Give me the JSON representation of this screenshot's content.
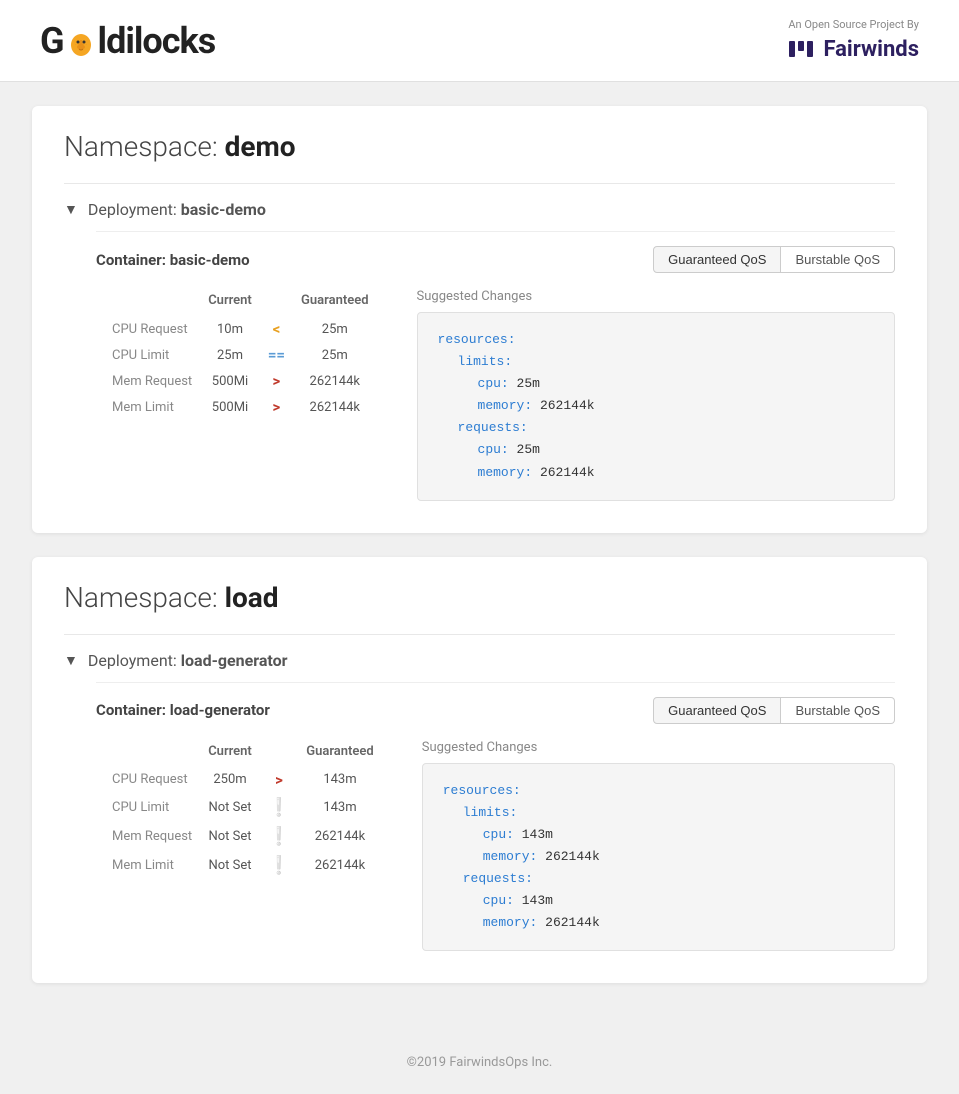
{
  "header": {
    "logo_text_before": "G",
    "logo_text_after": "ldilocks",
    "brand_tagline": "An Open Source Project By",
    "brand_name": "Fairwinds"
  },
  "footer": {
    "copyright": "©2019 FairwindsOps Inc."
  },
  "namespaces": [
    {
      "id": "demo",
      "label": "Namespace:",
      "name": "demo",
      "deployments": [
        {
          "label": "Deployment:",
          "name": "basic-demo",
          "containers": [
            {
              "name": "basic-demo",
              "qos_buttons": [
                "Guaranteed QoS",
                "Burstable QoS"
              ],
              "active_qos": 0,
              "columns": [
                "Current",
                "Guaranteed"
              ],
              "suggested_label": "Suggested Changes",
              "rows": [
                {
                  "label": "CPU Request",
                  "current": "10m",
                  "indicator": "<",
                  "indicator_class": "lt",
                  "guaranteed": "25m"
                },
                {
                  "label": "CPU Limit",
                  "current": "25m",
                  "indicator": "=",
                  "indicator_class": "eq",
                  "guaranteed": "25m"
                },
                {
                  "label": "Mem Request",
                  "current": "500Mi",
                  "indicator": ">",
                  "indicator_class": "gt",
                  "guaranteed": "262144k"
                },
                {
                  "label": "Mem Limit",
                  "current": "500Mi",
                  "indicator": ">",
                  "indicator_class": "gt",
                  "guaranteed": "262144k"
                }
              ],
              "code": {
                "resources_key": "resources:",
                "limits_key": "  limits:",
                "limits_cpu_key": "    cpu:",
                "limits_cpu_val": "25m",
                "limits_mem_key": "    memory:",
                "limits_mem_val": "262144k",
                "requests_key": "  requests:",
                "requests_cpu_key": "    cpu:",
                "requests_cpu_val": "25m",
                "requests_mem_key": "    memory:",
                "requests_mem_val": "262144k"
              }
            }
          ]
        }
      ]
    },
    {
      "id": "load",
      "label": "Namespace:",
      "name": "load",
      "deployments": [
        {
          "label": "Deployment:",
          "name": "load-generator",
          "containers": [
            {
              "name": "load-generator",
              "qos_buttons": [
                "Guaranteed QoS",
                "Burstable QoS"
              ],
              "active_qos": 0,
              "columns": [
                "Current",
                "Guaranteed"
              ],
              "suggested_label": "Suggested Changes",
              "rows": [
                {
                  "label": "CPU Request",
                  "current": "250m",
                  "indicator": ">",
                  "indicator_class": "gt",
                  "guaranteed": "143m"
                },
                {
                  "label": "CPU Limit",
                  "current": "Not Set",
                  "indicator": "!",
                  "indicator_class": "warn",
                  "guaranteed": "143m"
                },
                {
                  "label": "Mem Request",
                  "current": "Not Set",
                  "indicator": "!",
                  "indicator_class": "warn",
                  "guaranteed": "262144k"
                },
                {
                  "label": "Mem Limit",
                  "current": "Not Set",
                  "indicator": "!",
                  "indicator_class": "warn",
                  "guaranteed": "262144k"
                }
              ],
              "code": {
                "resources_key": "resources:",
                "limits_key": "  limits:",
                "limits_cpu_key": "    cpu:",
                "limits_cpu_val": "143m",
                "limits_mem_key": "    memory:",
                "limits_mem_val": "262144k",
                "requests_key": "  requests:",
                "requests_cpu_key": "    cpu:",
                "requests_cpu_val": "143m",
                "requests_mem_key": "    memory:",
                "requests_mem_val": "262144k"
              }
            }
          ]
        }
      ]
    }
  ]
}
